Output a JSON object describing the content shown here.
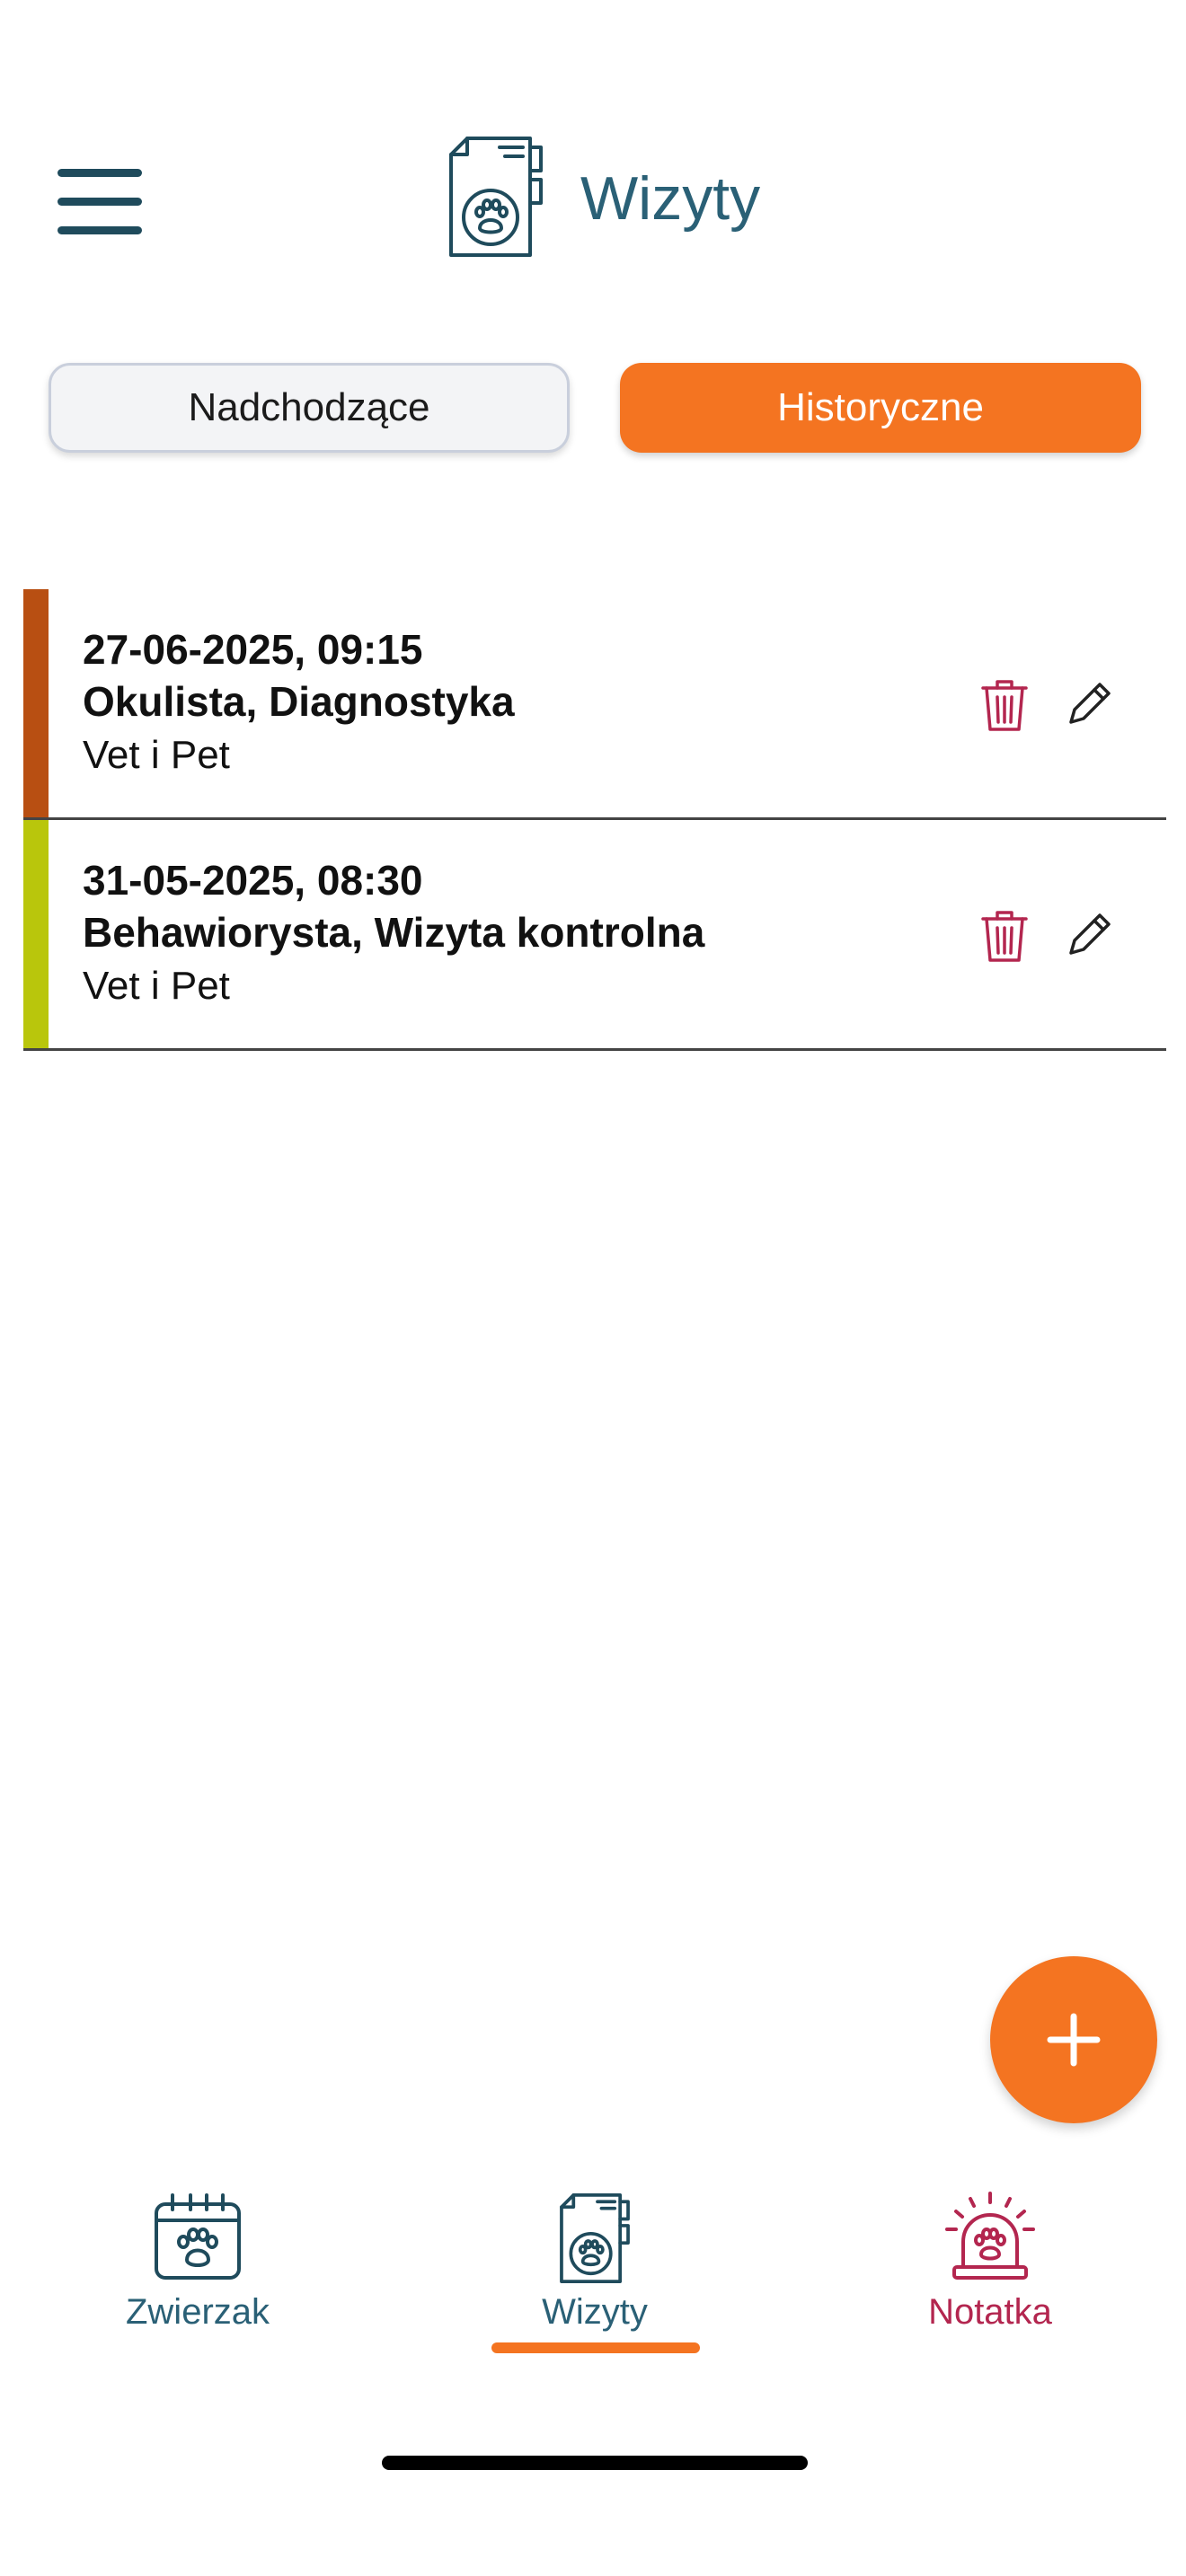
{
  "header": {
    "title": "Wizyty",
    "menu_icon": "hamburger-menu-icon",
    "title_icon": "vet-document-paw-icon"
  },
  "segments": {
    "upcoming_label": "Nadchodzące",
    "history_label": "Historyczne",
    "active": "history"
  },
  "visits": [
    {
      "date": "27-06-2025, 09:15",
      "type": "Okulista, Diagnostyka",
      "clinic": "Vet i Pet",
      "color": "#b84f12"
    },
    {
      "date": "31-05-2025, 08:30",
      "type": "Behawiorysta, Wizyta kontrolna",
      "clinic": "Vet i Pet",
      "color": "#b9c60c"
    }
  ],
  "fab": {
    "icon": "plus-icon"
  },
  "bottom_nav": {
    "items": [
      {
        "label": "Zwierzak",
        "icon": "calendar-paw-icon",
        "color": "#2a6076"
      },
      {
        "label": "Wizyty",
        "icon": "vet-document-paw-icon",
        "color": "#2a6076",
        "active": true
      },
      {
        "label": "Notatka",
        "icon": "alarm-paw-icon",
        "color": "#b3264f"
      }
    ]
  },
  "colors": {
    "accent": "#f47421",
    "primary": "#2a6076",
    "danger": "#b3264f"
  }
}
